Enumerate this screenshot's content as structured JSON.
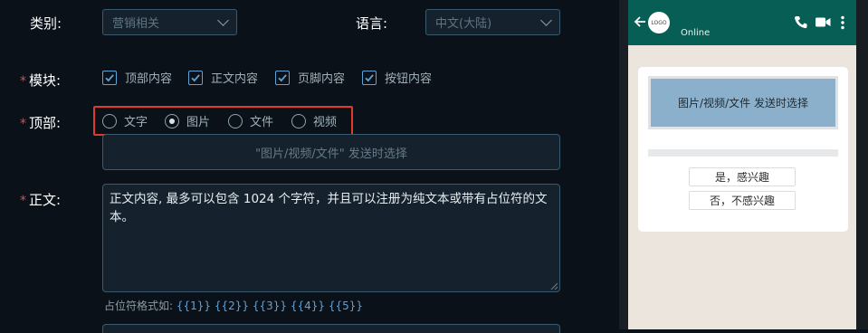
{
  "form": {
    "category_label": "类别:",
    "category_value": "营销相关",
    "language_label": "语言:",
    "language_value": "中文(大陆)",
    "module_label": "模块:",
    "modules": [
      {
        "label": "顶部内容",
        "checked": true
      },
      {
        "label": "正文内容",
        "checked": true
      },
      {
        "label": "页脚内容",
        "checked": true
      },
      {
        "label": "按钮内容",
        "checked": true
      }
    ],
    "header_label": "顶部:",
    "header_types": [
      {
        "label": "文字",
        "selected": false
      },
      {
        "label": "图片",
        "selected": true
      },
      {
        "label": "文件",
        "selected": false
      },
      {
        "label": "视频",
        "selected": false
      }
    ],
    "header_input_placeholder": "\"图片/视频/文件\" 发送时选择",
    "body_label": "正文:",
    "body_value": "正文内容, 最多可以包含 1024 个字符，并且可以注册为纯文本或带有占位符的文本。",
    "placeholder_hint_label": "占位符格式如:",
    "placeholder_hint_vars": "{{1}} {{2}} {{3}} {{4}} {{5}}",
    "required_mark": "*"
  },
  "preview": {
    "logo_text": "LOGO",
    "status": "Online",
    "media_text": "图片/视频/文件 发送时选择",
    "replies": [
      "是，感兴趣",
      "否，不感兴趣"
    ],
    "header_color": "#075e54",
    "chat_bg": "#ece5dd"
  },
  "colors": {
    "accent": "#5fa2d6",
    "highlight_border": "#e23a2c",
    "required": "#e5484d"
  }
}
